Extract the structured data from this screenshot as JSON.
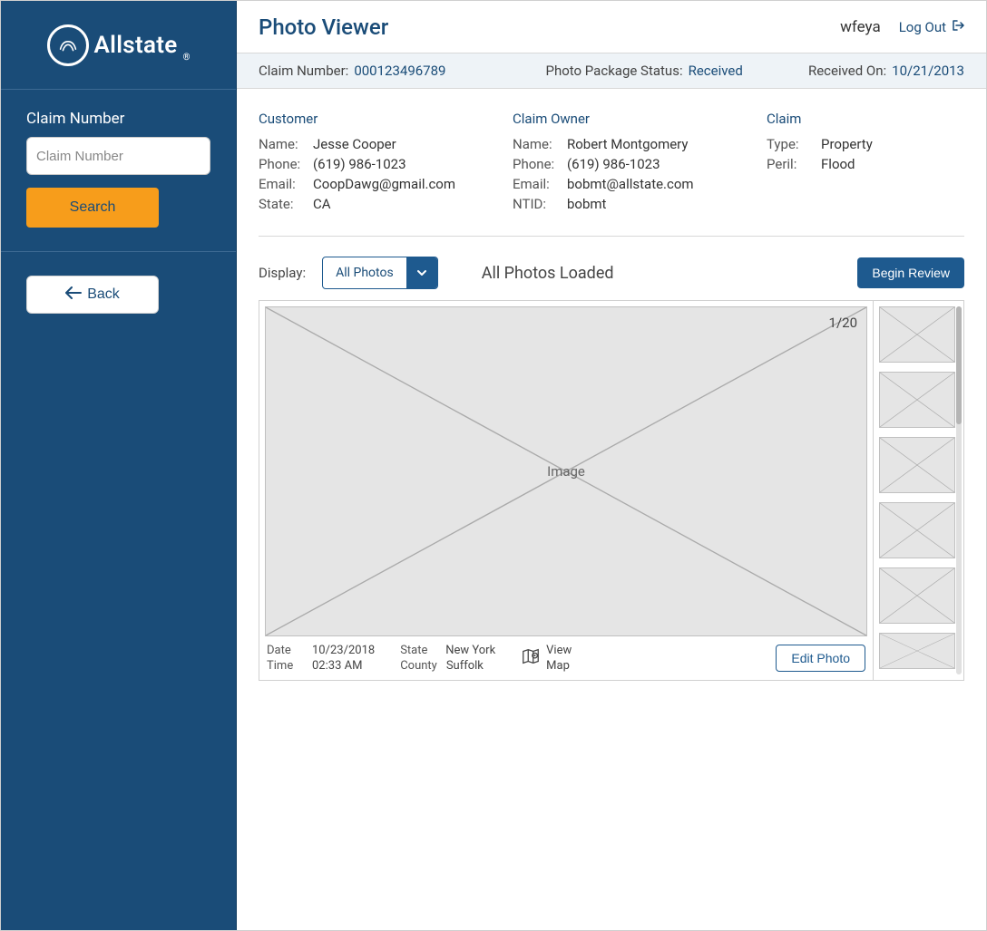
{
  "brand": {
    "name": "Allstate"
  },
  "sidebar": {
    "claim_label": "Claim Number",
    "claim_placeholder": "Claim Number",
    "search_label": "Search",
    "back_label": "Back"
  },
  "header": {
    "title": "Photo Viewer",
    "username": "wfeya",
    "logout_label": "Log Out"
  },
  "infobar": {
    "claim_number_label": "Claim Number:",
    "claim_number_value": "000123496789",
    "package_status_label": "Photo Package Status:",
    "package_status_value": "Received",
    "received_on_label": "Received On:",
    "received_on_value": "10/21/2013"
  },
  "customer": {
    "heading": "Customer",
    "name_label": "Name:",
    "name_value": "Jesse Cooper",
    "phone_label": "Phone:",
    "phone_value": "(619) 986-1023",
    "email_label": "Email:",
    "email_value": "CoopDawg@gmail.com",
    "state_label": "State:",
    "state_value": "CA"
  },
  "owner": {
    "heading": "Claim Owner",
    "name_label": "Name:",
    "name_value": "Robert Montgomery",
    "phone_label": "Phone:",
    "phone_value": "(619) 986-1023",
    "email_label": "Email:",
    "email_value": "bobmt@allstate.com",
    "ntid_label": "NTID:",
    "ntid_value": "bobmt"
  },
  "claim": {
    "heading": "Claim",
    "type_label": "Type:",
    "type_value": "Property",
    "peril_label": "Peril:",
    "peril_value": "Flood"
  },
  "display": {
    "label": "Display:",
    "selected": "All Photos",
    "loaded_text": "All Photos Loaded",
    "begin_review_label": "Begin Review"
  },
  "viewer": {
    "image_placeholder": "Image",
    "count": "1/20",
    "date_label": "Date",
    "date_value": "10/23/2018",
    "time_label": "Time",
    "time_value": "02:33 AM",
    "state_label": "State",
    "state_value": "New York",
    "county_label": "County",
    "county_value": "Suffolk",
    "view_map_line1": "View",
    "view_map_line2": "Map",
    "edit_photo_label": "Edit Photo"
  }
}
